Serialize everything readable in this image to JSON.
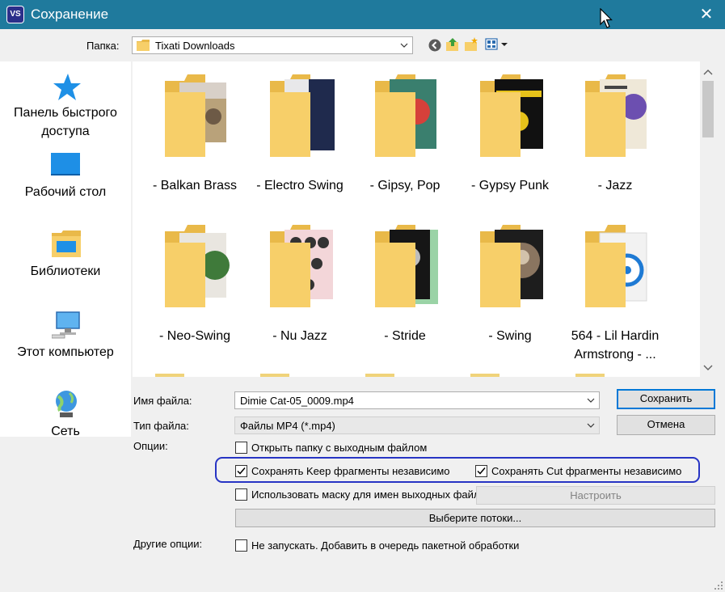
{
  "window": {
    "app_icon": "VS",
    "title": "Сохранение",
    "close_glyph": "✕"
  },
  "folder": {
    "label": "Папка:",
    "value": "Tixati Downloads"
  },
  "places": [
    {
      "label": "Панель быстрого доступа",
      "icon": "star-icon"
    },
    {
      "label": "Рабочий стол",
      "icon": "desktop-icon"
    },
    {
      "label": "Библиотеки",
      "icon": "libraries-icon"
    },
    {
      "label": "Этот компьютер",
      "icon": "computer-icon"
    },
    {
      "label": "Сеть",
      "icon": "network-icon"
    }
  ],
  "files": [
    {
      "name": "- Balkan Brass"
    },
    {
      "name": "- Electro Swing"
    },
    {
      "name": "- Gipsy, Pop"
    },
    {
      "name": "- Gypsy Punk"
    },
    {
      "name": "- Jazz"
    },
    {
      "name": "- Neo-Swing"
    },
    {
      "name": "- Nu Jazz"
    },
    {
      "name": "- Stride"
    },
    {
      "name": "- Swing"
    },
    {
      "name": "564 - Lil Hardin Armstrong - ..."
    }
  ],
  "filename": {
    "label": "Имя файла:",
    "value": "Dimie Cat-05_0009.mp4"
  },
  "filetype": {
    "label": "Тип файла:",
    "value": "Файлы MP4 (*.mp4)"
  },
  "buttons": {
    "save": "Сохранить",
    "cancel": "Отмена",
    "configure": "Настроить",
    "streams": "Выберите потоки..."
  },
  "options": {
    "label": "Опции:",
    "open_folder": {
      "label": "Открыть папку с выходным файлом",
      "checked": false
    },
    "keep_fragments": {
      "label": "Сохранять Keep фрагменты независимо",
      "checked": true
    },
    "cut_fragments": {
      "label": "Сохранять Cut фрагменты независимо",
      "checked": true
    },
    "use_mask": {
      "label": "Использовать маску для имен выходных файлов",
      "checked": false
    }
  },
  "other_options": {
    "label": "Другие опции:",
    "no_start": {
      "label": "Не запускать. Добавить в очередь пакетной обработки",
      "checked": false
    }
  },
  "colors": {
    "titlebar": "#1f7a9d",
    "highlight": "#2734c4",
    "folder": "#f7cf69"
  }
}
